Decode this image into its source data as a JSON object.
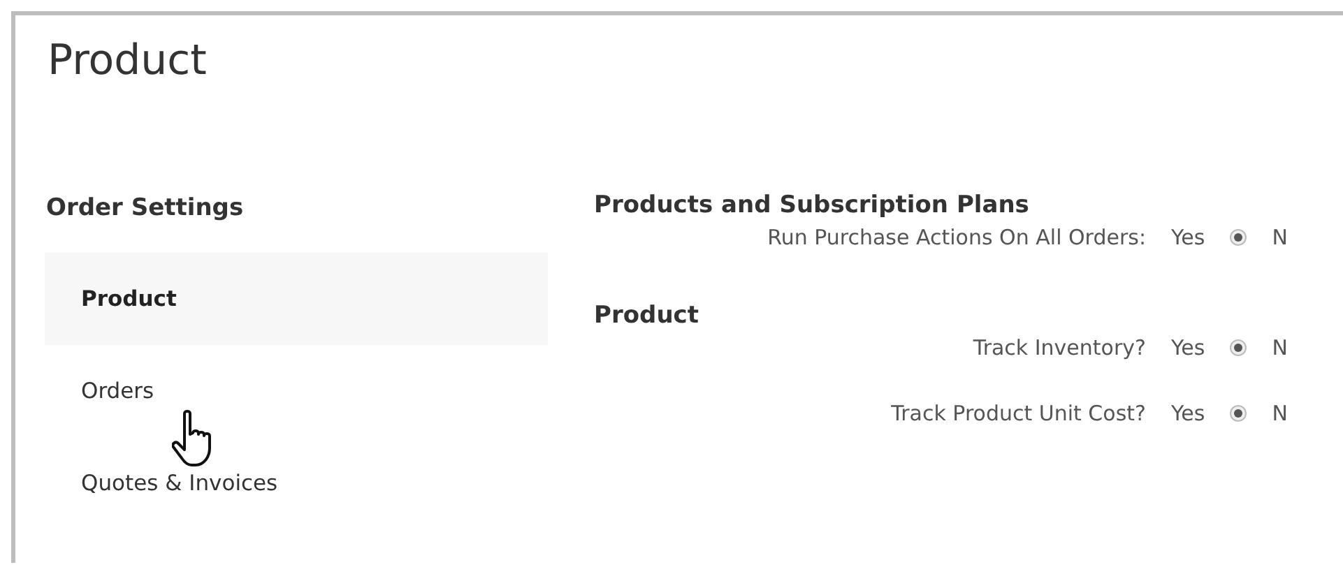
{
  "page": {
    "title": "Product"
  },
  "sidebar": {
    "heading": "Order Settings",
    "items": [
      {
        "label": "Product",
        "selected": true
      },
      {
        "label": "Orders",
        "selected": false
      },
      {
        "label": "Quotes & Invoices",
        "selected": false
      }
    ]
  },
  "sections": [
    {
      "heading": "Products and Subscription Plans",
      "settings": [
        {
          "label": "Run Purchase Actions On All Orders:",
          "yes_label": "Yes",
          "yes_selected": true,
          "no_label": "N"
        }
      ]
    },
    {
      "heading": "Product",
      "settings": [
        {
          "label": "Track Inventory?",
          "yes_label": "Yes",
          "yes_selected": true,
          "no_label": "N"
        },
        {
          "label": "Track Product Unit Cost?",
          "yes_label": "Yes",
          "yes_selected": true,
          "no_label": "N"
        }
      ]
    }
  ]
}
